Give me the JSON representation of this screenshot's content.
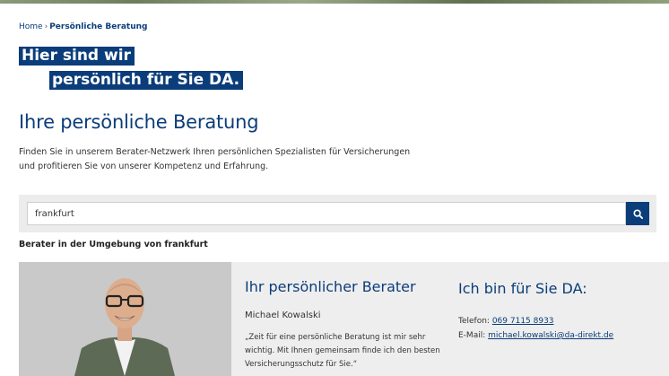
{
  "breadcrumb": {
    "home": "Home",
    "separator": "›",
    "current": "Persönliche Beratung"
  },
  "slogan": {
    "line1": "Hier sind wir",
    "line2": "persönlich für Sie DA."
  },
  "page": {
    "title": "Ihre persönliche Beratung",
    "intro": "Finden Sie in unserem Berater-Netzwerk Ihren persönlichen Spezialisten für Versicherungen und profitieren Sie von unserer Kompetenz und Erfahrung."
  },
  "search": {
    "value": "frankfurt",
    "icon": "search-icon"
  },
  "results": {
    "heading": "Berater in der Umgebung von frankfurt"
  },
  "advisor": {
    "card_title": "Ihr persönlicher Berater",
    "name": "Michael Kowalski",
    "quote": "„Zeit für eine persönliche Beratung ist mir sehr wichtig. Mit Ihnen gemeinsam finde ich den besten Versicherungsschutz für Sie.“",
    "contact_title": "Ich bin für Sie DA:",
    "phone_label": "Telefon:",
    "phone": "069 7115 8933",
    "email_label": "E-Mail:",
    "email": "michael.kowalski@da-direkt.de"
  },
  "colors": {
    "brand": "#0b3d7a",
    "panel": "#ececec"
  }
}
